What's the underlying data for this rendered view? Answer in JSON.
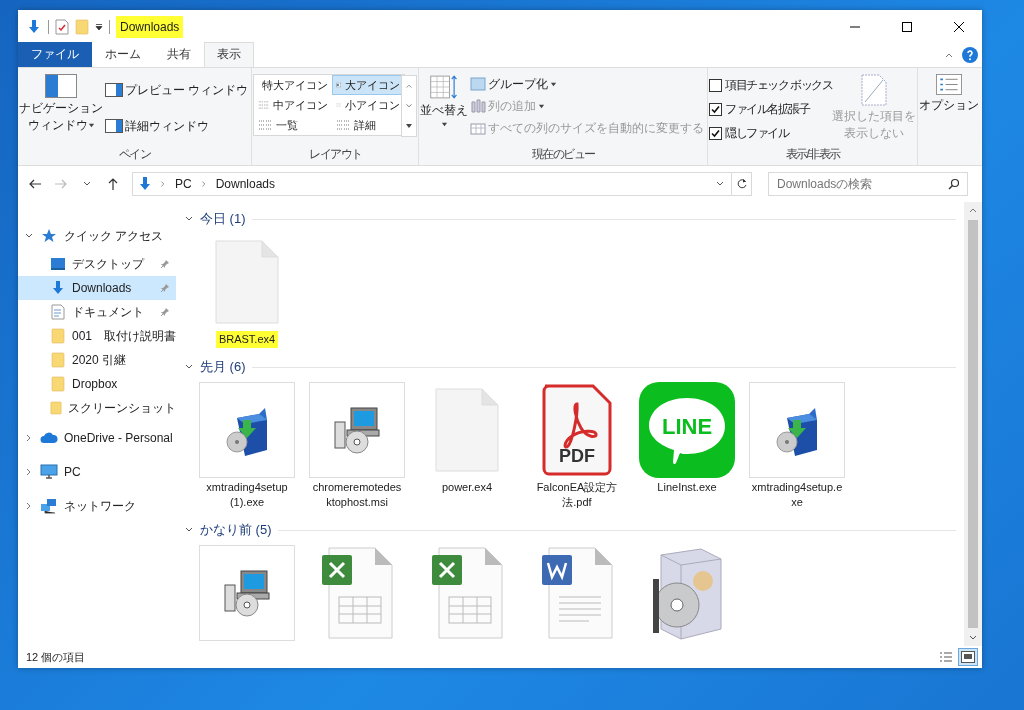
{
  "window": {
    "title": "Downloads",
    "title_highlighted": true
  },
  "ribbon_tabs": [
    {
      "label": "ファイル",
      "kind": "file",
      "selected": false
    },
    {
      "label": "ホーム",
      "kind": "tab",
      "selected": false
    },
    {
      "label": "共有",
      "kind": "tab",
      "selected": false
    },
    {
      "label": "表示",
      "kind": "tab",
      "selected": true
    }
  ],
  "pane_group": {
    "title": "ペイン",
    "navigation_pane": [
      "ナビゲーション",
      "ウィンドウ"
    ],
    "preview_pane": "プレビュー ウィンドウ",
    "details_pane": "詳細ウィンドウ"
  },
  "layout_group": {
    "title": "レイアウト",
    "options": [
      {
        "label": "特大アイコン",
        "kind": "xl",
        "selected": false
      },
      {
        "label": "大アイコン",
        "kind": "large",
        "selected": true
      },
      {
        "label": "中アイコン",
        "kind": "medium",
        "selected": false
      },
      {
        "label": "小アイコン",
        "kind": "small",
        "selected": false
      },
      {
        "label": "一覧",
        "kind": "list",
        "selected": false
      },
      {
        "label": "詳細",
        "kind": "details",
        "selected": false
      }
    ]
  },
  "current_view_group": {
    "title": "現在のビュー",
    "sort": "並べ替え",
    "items": [
      {
        "label": "グループ化",
        "kind": "group",
        "dropdown": true,
        "disabled": false
      },
      {
        "label": "列の追加",
        "kind": "add",
        "dropdown": true,
        "disabled": true
      },
      {
        "label": "すべての列のサイズを自動的に変更する",
        "kind": "fit",
        "dropdown": false,
        "disabled": true
      }
    ]
  },
  "show_hide_group": {
    "title": "表示/非表示",
    "checkboxes": [
      {
        "label": "項目チェック ボックス",
        "checked": false
      },
      {
        "label": "ファイル名拡張子",
        "checked": true
      },
      {
        "label": "隠しファイル",
        "checked": true
      }
    ],
    "hide_selected": {
      "lines": [
        "選択した項目を",
        "表示しない"
      ],
      "disabled": true
    }
  },
  "options_button": "オプション",
  "address_bar": {
    "path": [
      "PC",
      "Downloads"
    ]
  },
  "search": {
    "placeholder": "Downloadsの検索"
  },
  "sidebar": [
    {
      "label": "クイック アクセス",
      "kind": "star",
      "expanded": true,
      "selected": false,
      "children": [
        {
          "label": "デスクトップ",
          "kind": "desktop",
          "pinned": true,
          "selected": false
        },
        {
          "label": "Downloads",
          "kind": "download",
          "pinned": true,
          "selected": true
        },
        {
          "label": "ドキュメント",
          "kind": "document",
          "pinned": true,
          "selected": false
        },
        {
          "label": "001　取付け説明書",
          "kind": "folder",
          "pinned": false,
          "selected": false
        },
        {
          "label": "2020 引継",
          "kind": "folder",
          "pinned": false,
          "selected": false
        },
        {
          "label": "Dropbox",
          "kind": "folder",
          "pinned": false,
          "selected": false
        },
        {
          "label": "スクリーンショット",
          "kind": "folder",
          "pinned": false,
          "selected": false
        }
      ]
    },
    {
      "label": "OneDrive - Personal",
      "kind": "cloud",
      "expanded": false,
      "selected": false
    },
    {
      "label": "PC",
      "kind": "pc",
      "expanded": false,
      "selected": false
    },
    {
      "label": "ネットワーク",
      "kind": "network",
      "expanded": false,
      "selected": false
    }
  ],
  "file_groups": [
    {
      "title": "今日 (1)",
      "expanded": true,
      "items": [
        {
          "name": "BRAST.ex4",
          "kind": "blank",
          "highlighted": true
        }
      ]
    },
    {
      "title": "先月 (6)",
      "expanded": true,
      "items": [
        {
          "name": "xmtrading4setup (1).exe",
          "kind": "installer",
          "highlighted": false
        },
        {
          "name": "chromeremotedesktophost.msi",
          "kind": "msi",
          "highlighted": false
        },
        {
          "name": "power.ex4",
          "kind": "blank",
          "highlighted": false
        },
        {
          "name": "FalconEA設定方法.pdf",
          "kind": "pdf",
          "icon_text": "PDF",
          "highlighted": false
        },
        {
          "name": "LineInst.exe",
          "kind": "line",
          "icon_text": "LINE",
          "highlighted": false
        },
        {
          "name": "xmtrading4setup.exe",
          "kind": "installer",
          "highlighted": false
        }
      ]
    },
    {
      "title": "かなり前 (5)",
      "expanded": true,
      "items": [
        {
          "kind": "msi"
        },
        {
          "kind": "excel"
        },
        {
          "kind": "excel"
        },
        {
          "kind": "word"
        },
        {
          "kind": "box"
        }
      ]
    }
  ],
  "status_bar": {
    "count": "12 個の項目",
    "views": [
      {
        "kind": "details",
        "selected": false
      },
      {
        "kind": "large",
        "selected": true
      }
    ]
  }
}
